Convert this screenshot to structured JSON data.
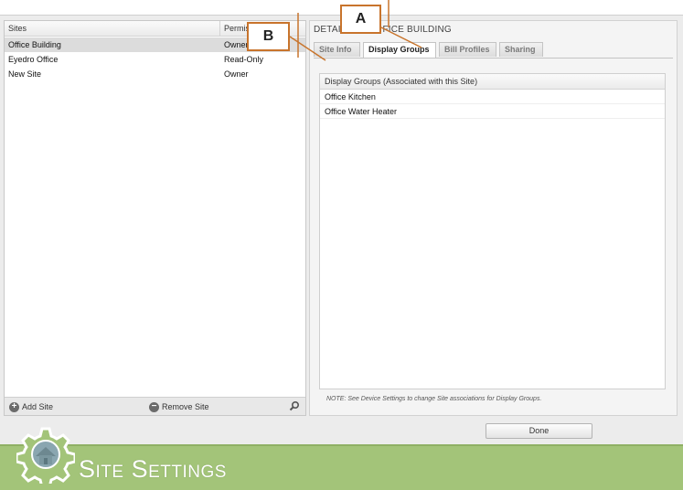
{
  "sites_table": {
    "columns": [
      "Sites",
      "Permis"
    ],
    "rows": [
      {
        "name": "Office Building",
        "permission": "Owner",
        "selected": true
      },
      {
        "name": "Eyedro Office",
        "permission": "Read-Only",
        "selected": false
      },
      {
        "name": "New Site",
        "permission": "Owner",
        "selected": false
      }
    ]
  },
  "footer": {
    "add_label": "Add Site",
    "remove_label": "Remove Site"
  },
  "detail": {
    "title_left": "DETAIL",
    "title_right": "FICE BUILDING",
    "tabs": [
      {
        "label": "Site Info",
        "active": false
      },
      {
        "label": "Display Groups",
        "active": true
      },
      {
        "label": "Bill Profiles",
        "active": false
      },
      {
        "label": "Sharing",
        "active": false
      }
    ],
    "groups_header": "Display Groups (Associated with this Site)",
    "groups": [
      "Office Kitchen",
      "Office Water Heater"
    ],
    "note": "NOTE: See Device Settings to change Site associations for Display Groups."
  },
  "done_label": "Done",
  "banner_title": "Site Settings",
  "callouts": {
    "a": "A",
    "b": "B"
  },
  "colors": {
    "banner": "#a3c479",
    "callout_border": "#c8742c",
    "selected_row": "#dcdcdc"
  },
  "icons": {
    "banner": "gear-icon",
    "add": "plus-icon",
    "remove": "minus-icon",
    "search": "search-icon"
  }
}
